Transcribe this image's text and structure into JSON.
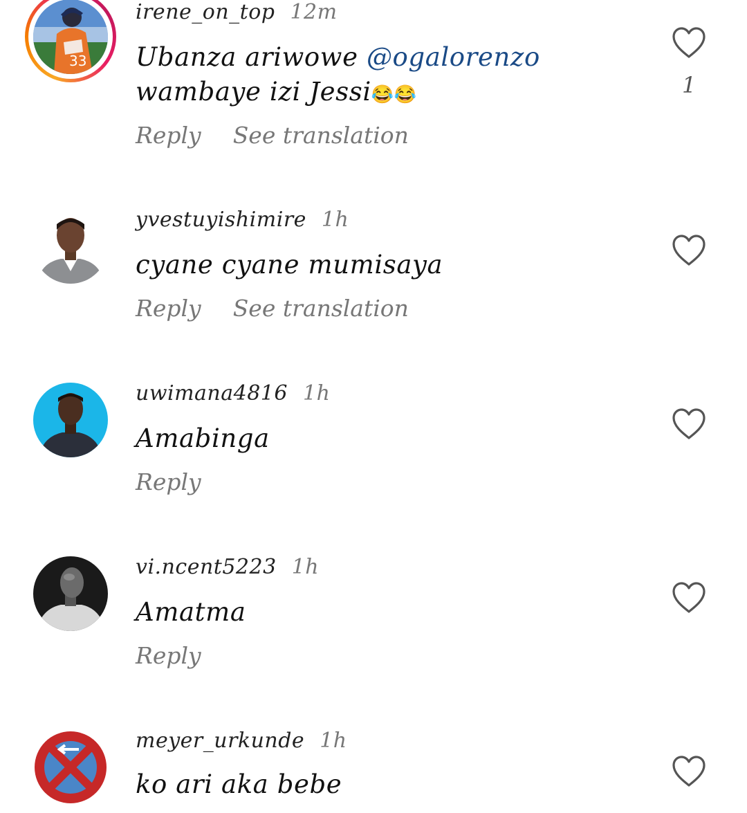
{
  "comments": [
    {
      "username": "irene_on_top",
      "time": "12m",
      "text_before": "Ubanza ariwowe ",
      "mention": "@ogalorenzo",
      "text_after": " wambaye izi Jessi",
      "emoji": "😂😂",
      "reply_label": "Reply",
      "translate_label": "See translation",
      "likes": "1",
      "has_story": true
    },
    {
      "username": "yvestuyishimire",
      "time": "1h",
      "text": "cyane cyane mumisaya",
      "reply_label": "Reply",
      "translate_label": "See translation"
    },
    {
      "username": "uwimana4816",
      "time": "1h",
      "text": "Amabinga",
      "reply_label": "Reply"
    },
    {
      "username": "vi.ncent5223",
      "time": "1h",
      "text": "Amatma",
      "reply_label": "Reply"
    },
    {
      "username": "meyer_urkunde",
      "time": "1h",
      "text": "ko ari aka bebe"
    }
  ],
  "icons": {
    "like": "heart-outline-icon"
  },
  "colors": {
    "mention": "#1a4a86",
    "secondary_text": "#777777",
    "story_ring_start": "#f9a825",
    "story_ring_end": "#e91e63"
  }
}
